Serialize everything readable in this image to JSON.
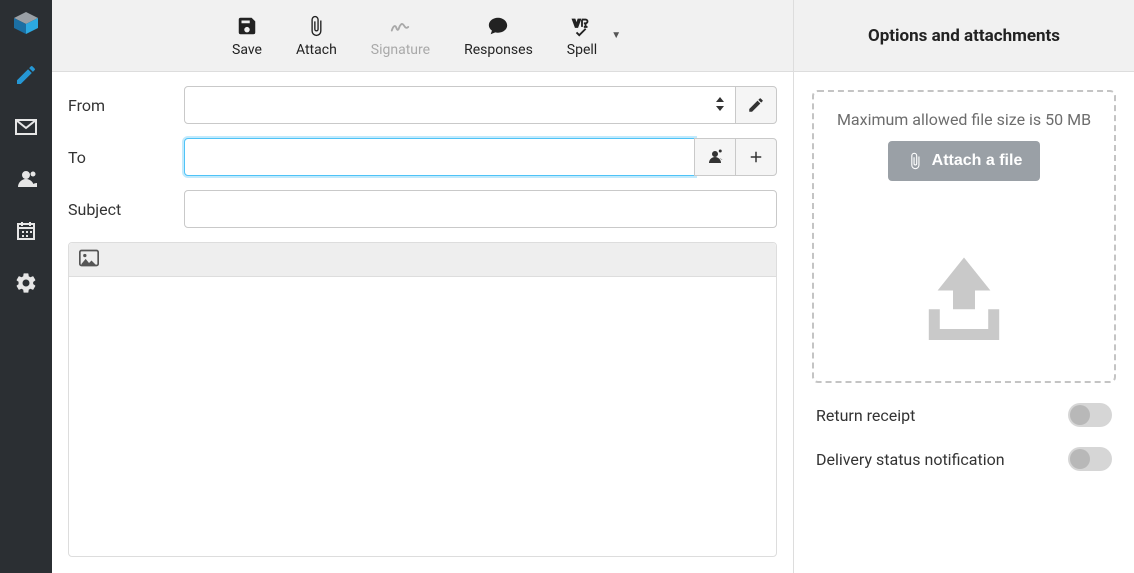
{
  "toolbar": {
    "save": "Save",
    "attach": "Attach",
    "signature": "Signature",
    "responses": "Responses",
    "spell": "Spell"
  },
  "fields": {
    "from_label": "From",
    "from_value": "",
    "to_label": "To",
    "to_value": "",
    "subject_label": "Subject",
    "subject_value": ""
  },
  "side": {
    "header": "Options and attachments",
    "max_size_text": "Maximum allowed file size is 50 MB",
    "attach_button": "Attach a file",
    "return_receipt_label": "Return receipt",
    "delivery_status_label": "Delivery status notification"
  }
}
